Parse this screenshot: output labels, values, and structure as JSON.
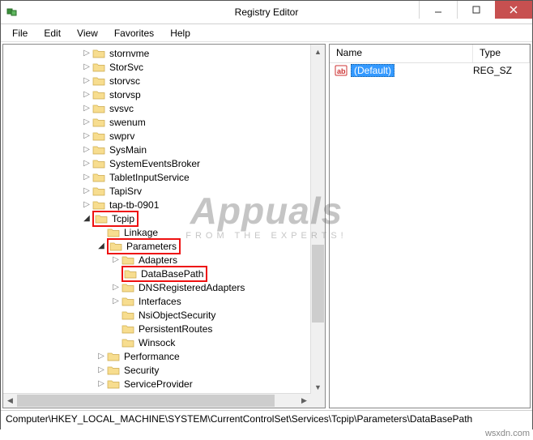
{
  "window": {
    "title": "Registry Editor"
  },
  "menu": {
    "file": "File",
    "edit": "Edit",
    "view": "View",
    "favorites": "Favorites",
    "help": "Help"
  },
  "tree": {
    "items": [
      {
        "depth": 5,
        "exp": "closed",
        "label": "stornvme",
        "hl": false
      },
      {
        "depth": 5,
        "exp": "closed",
        "label": "StorSvc",
        "hl": false
      },
      {
        "depth": 5,
        "exp": "closed",
        "label": "storvsc",
        "hl": false
      },
      {
        "depth": 5,
        "exp": "closed",
        "label": "storvsp",
        "hl": false
      },
      {
        "depth": 5,
        "exp": "closed",
        "label": "svsvc",
        "hl": false
      },
      {
        "depth": 5,
        "exp": "closed",
        "label": "swenum",
        "hl": false
      },
      {
        "depth": 5,
        "exp": "closed",
        "label": "swprv",
        "hl": false
      },
      {
        "depth": 5,
        "exp": "closed",
        "label": "SysMain",
        "hl": false
      },
      {
        "depth": 5,
        "exp": "closed",
        "label": "SystemEventsBroker",
        "hl": false
      },
      {
        "depth": 5,
        "exp": "closed",
        "label": "TabletInputService",
        "hl": false
      },
      {
        "depth": 5,
        "exp": "closed",
        "label": "TapiSrv",
        "hl": false
      },
      {
        "depth": 5,
        "exp": "closed",
        "label": "tap-tb-0901",
        "hl": false
      },
      {
        "depth": 5,
        "exp": "open",
        "label": "Tcpip",
        "hl": true
      },
      {
        "depth": 6,
        "exp": "none",
        "label": "Linkage",
        "hl": false
      },
      {
        "depth": 6,
        "exp": "open",
        "label": "Parameters",
        "hl": true
      },
      {
        "depth": 7,
        "exp": "closed",
        "label": "Adapters",
        "hl": false
      },
      {
        "depth": 7,
        "exp": "none",
        "label": "DataBasePath",
        "hl": true
      },
      {
        "depth": 7,
        "exp": "closed",
        "label": "DNSRegisteredAdapters",
        "hl": false
      },
      {
        "depth": 7,
        "exp": "closed",
        "label": "Interfaces",
        "hl": false
      },
      {
        "depth": 7,
        "exp": "none",
        "label": "NsiObjectSecurity",
        "hl": false
      },
      {
        "depth": 7,
        "exp": "none",
        "label": "PersistentRoutes",
        "hl": false
      },
      {
        "depth": 7,
        "exp": "none",
        "label": "Winsock",
        "hl": false
      },
      {
        "depth": 6,
        "exp": "closed",
        "label": "Performance",
        "hl": false
      },
      {
        "depth": 6,
        "exp": "closed",
        "label": "Security",
        "hl": false
      },
      {
        "depth": 6,
        "exp": "closed",
        "label": "ServiceProvider",
        "hl": false
      }
    ]
  },
  "list": {
    "headers": {
      "name": "Name",
      "type": "Type"
    },
    "rows": [
      {
        "name": "(Default)",
        "type": "REG_SZ"
      }
    ]
  },
  "statusbar": {
    "path": "Computer\\HKEY_LOCAL_MACHINE\\SYSTEM\\CurrentControlSet\\Services\\Tcpip\\Parameters\\DataBasePath"
  },
  "watermark": {
    "brand": "Appuals",
    "sub": "FROM THE EXPERTS!"
  },
  "credit": "wsxdn.com"
}
